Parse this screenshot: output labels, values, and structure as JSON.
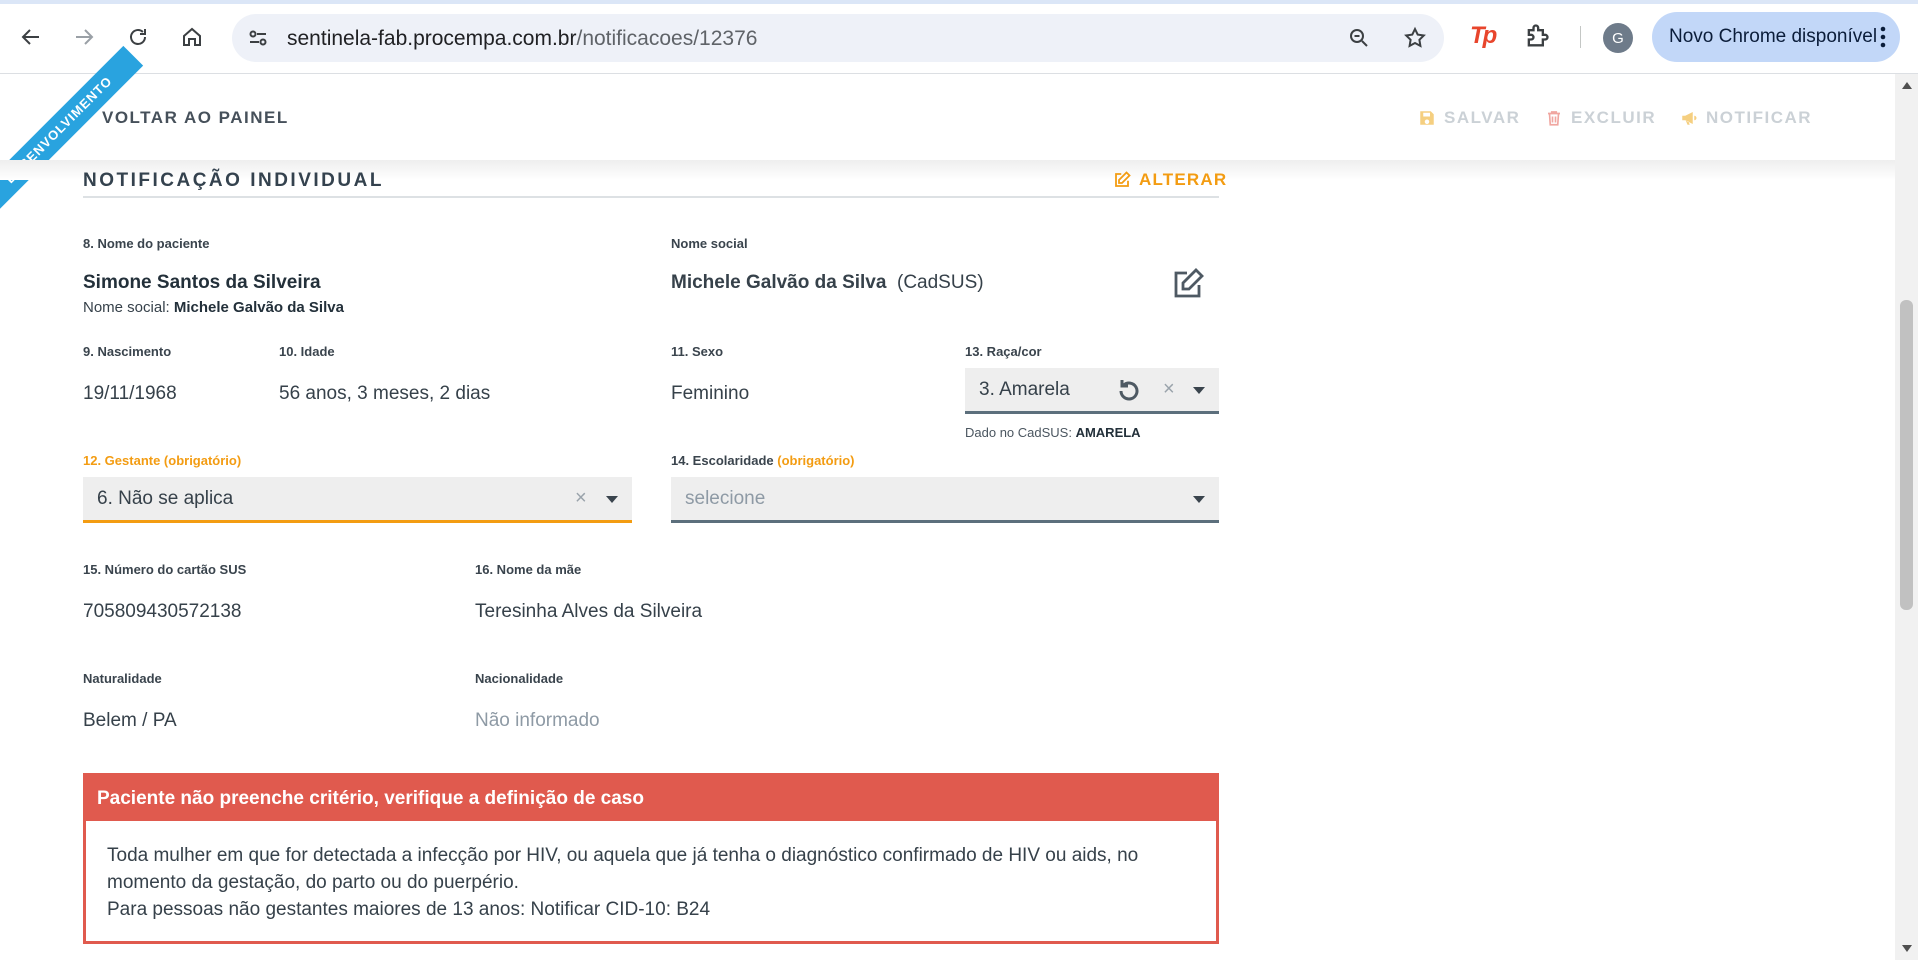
{
  "browser": {
    "url_host": "sentinela-fab.procempa.com.br",
    "url_path": "/notificacoes/12376",
    "update_label": "Novo Chrome disponível",
    "avatar_letter": "G",
    "extension_label": "Tp"
  },
  "ribbon": "DESENVOLVIMENTO",
  "toolbar": {
    "back_label": "VOLTAR AO PAINEL",
    "save_label": "SALVAR",
    "delete_label": "EXCLUIR",
    "notify_label": "NOTIFICAR"
  },
  "section": {
    "title": "NOTIFICAÇÃO INDIVIDUAL",
    "edit_label": "ALTERAR"
  },
  "patient": {
    "name_label": "8. Nome do paciente",
    "name": "Simone Santos da Silveira",
    "social_inline_prefix": "Nome social:",
    "social_inline_value": "Michele Galvão da Silva",
    "social_label": "Nome social",
    "social_name": "Michele Galvão da Silva",
    "social_source": "(CadSUS)",
    "birth_label": "9. Nascimento",
    "birth": "19/11/1968",
    "age_label": "10. Idade",
    "age": "56 anos, 3 meses, 2 dias",
    "sex_label": "11. Sexo",
    "sex": "Feminino",
    "race_label": "13. Raça/cor",
    "race_value": "3. Amarela",
    "race_cadsus_prefix": "Dado no CadSUS:",
    "race_cadsus_value": "AMARELA",
    "pregnant_label": "12. Gestante (obrigatório)",
    "pregnant_value": "6. Não se aplica",
    "education_label": "14. Escolaridade",
    "education_required": "(obrigatório)",
    "education_placeholder": "selecione",
    "sus_label": "15. Número do cartão SUS",
    "sus_number": "705809430572138",
    "mother_label": "16. Nome da mãe",
    "mother_name": "Teresinha Alves da Silveira",
    "birthplace_label": "Naturalidade",
    "birthplace": "Belem / PA",
    "nationality_label": "Nacionalidade",
    "nationality": "Não informado"
  },
  "alert": {
    "title": "Paciente não preenche critério, verifique a definição de caso",
    "line1": "Toda mulher em que for detectada a infecção por HIV, ou aquela que já tenha o diagnóstico confirmado de HIV ou aids, no momento da gestação, do parto ou do puerpério.",
    "line2": "Para pessoas não gestantes maiores de 13 anos: Notificar CID-10: B24"
  },
  "colors": {
    "accent_orange": "#f39c12",
    "alert_red": "#e05a4e",
    "ribbon_blue": "#29a3df"
  }
}
